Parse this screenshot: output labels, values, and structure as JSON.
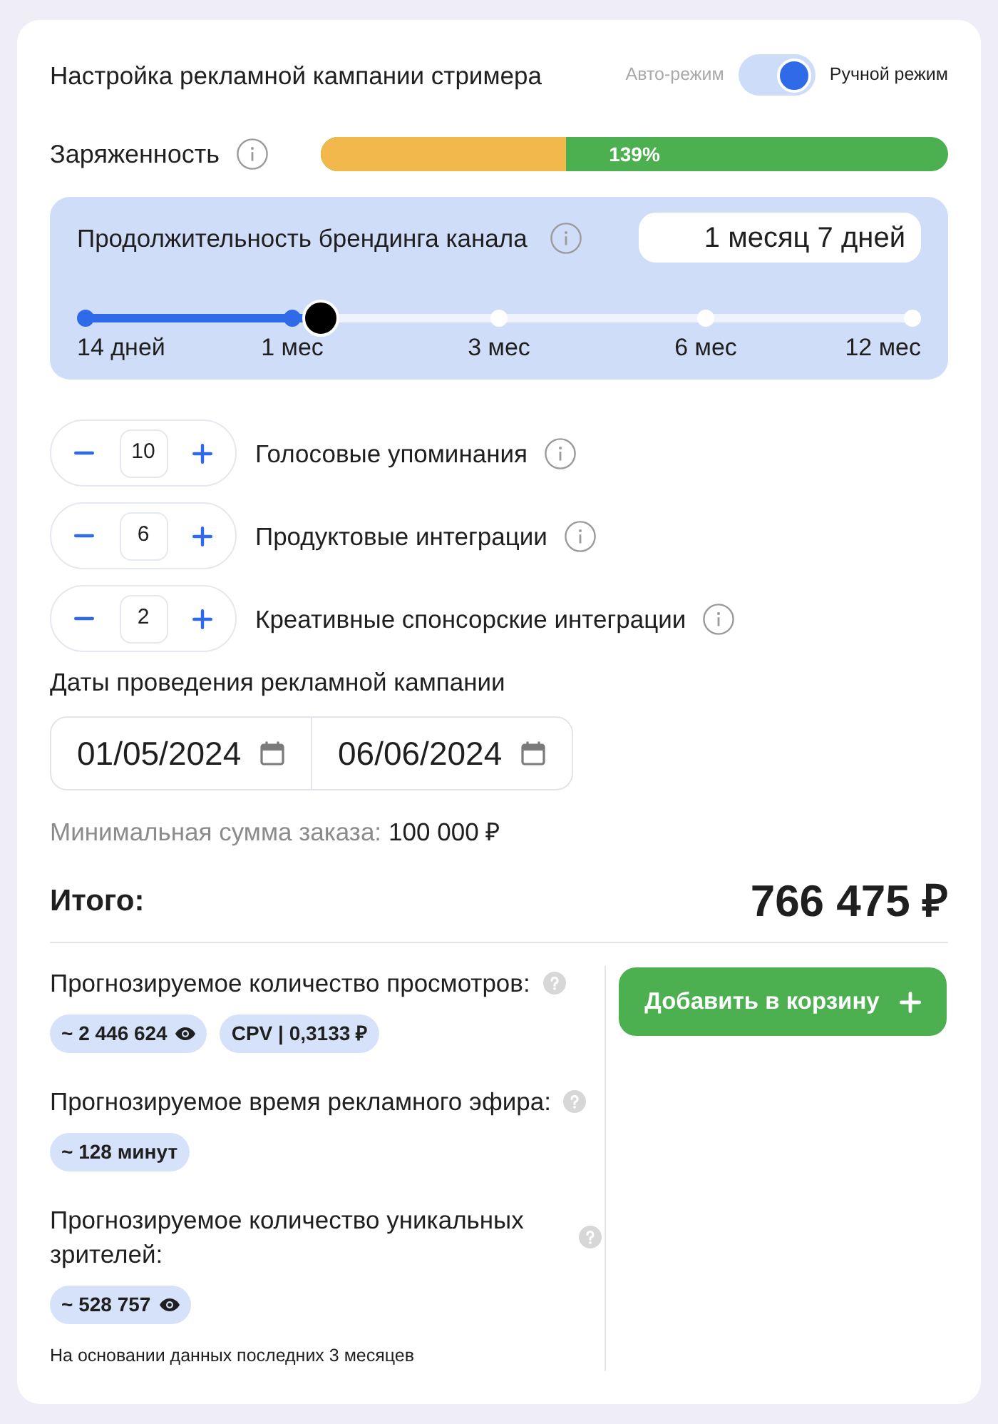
{
  "header": {
    "title": "Настройка рекламной кампании стримера",
    "mode_switch": {
      "off_label": "Авто-режим",
      "on_label": "Ручной режим",
      "on": true
    }
  },
  "charge": {
    "label": "Заряженность",
    "level": 0.39,
    "reading": "139%"
  },
  "branding": {
    "label": "Продолжительность брендинга канала",
    "value": "1 месяц 7 дней",
    "slider": {
      "level": 0.284,
      "ticks": [
        "14 дней",
        "1 мес",
        "3 мес",
        "6 мес",
        "12 мес"
      ]
    }
  },
  "counters": [
    {
      "value": "10",
      "label": "Голосовые упоминания"
    },
    {
      "value": "6",
      "label": "Продуктовые интеграции"
    },
    {
      "value": "2",
      "label": "Креативные спонсорские интеграции"
    }
  ],
  "dates": {
    "label": "Даты проведения рекламной кампании",
    "start": "01/05/2024",
    "end": "06/06/2024"
  },
  "minimum": {
    "label": "Минимальная сумма заказа:",
    "value": "100 000 ₽"
  },
  "total": {
    "label": "Итого:",
    "value": "766 475 ₽"
  },
  "forecasts": [
    {
      "label": "Прогнозируемое количество просмотров:",
      "chips": [
        {
          "kind": "views",
          "text": "~ 2 446 624"
        },
        {
          "kind": "plain",
          "text": "CPV | 0,3133 ₽"
        }
      ]
    },
    {
      "label": "Прогнозируемое время рекламного эфира:",
      "chips": [
        {
          "kind": "plain",
          "text": "~ 128 минут"
        }
      ]
    },
    {
      "label": "Прогнозируемое количество уникальных зрителей:",
      "chips": [
        {
          "kind": "views",
          "text": "~ 528 757"
        }
      ]
    }
  ],
  "footnote": "На основании данных последних 3 месяцев",
  "cart_button": {
    "label": "Добавить в корзину"
  }
}
